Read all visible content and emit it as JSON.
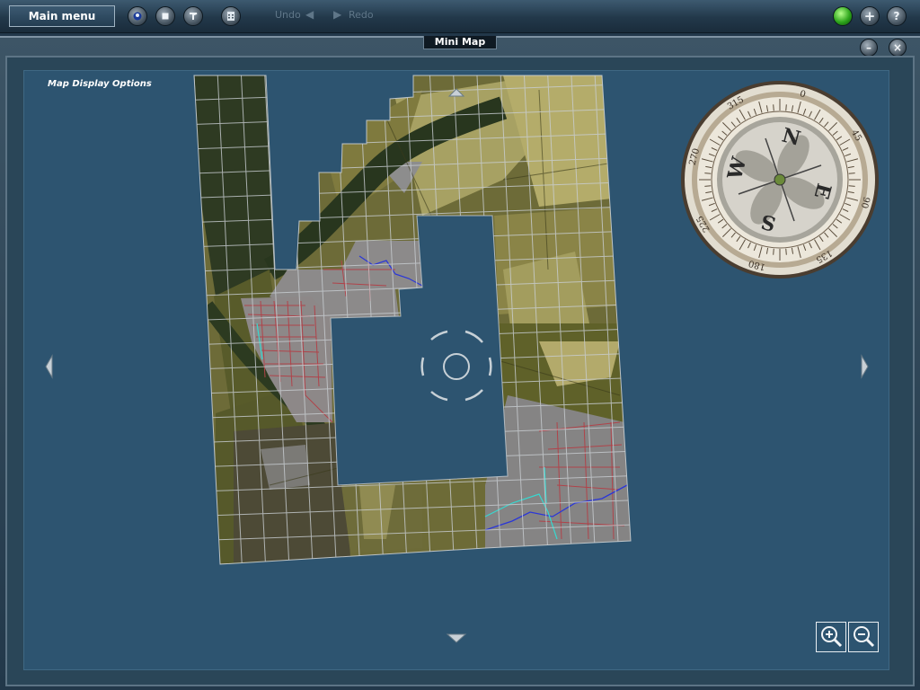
{
  "toolbar": {
    "main_menu_label": "Main menu",
    "undo_label": "Undo",
    "redo_label": "Redo",
    "tool_icons": [
      "view-icon",
      "stop-icon",
      "tools-icon",
      "calculator-icon"
    ],
    "right_icons": [
      "status-light-icon",
      "add-icon",
      "help-icon"
    ],
    "plus_glyph": "+",
    "help_glyph": "?",
    "undo_arrow": "◀",
    "redo_arrow": "▶"
  },
  "window": {
    "title": "Mini Map",
    "minimize_glyph": "–",
    "close_glyph": "×"
  },
  "map": {
    "options_label": "Map Display Options",
    "compass_labels": [
      "W",
      "N",
      "E",
      "S"
    ],
    "compass_degrees": [
      "270",
      "315",
      "0",
      "45",
      "90",
      "135",
      "180",
      "225"
    ]
  },
  "colors": {
    "background": "#22384a",
    "map_water": "#2d5470",
    "status_green": "#2ea51c"
  }
}
